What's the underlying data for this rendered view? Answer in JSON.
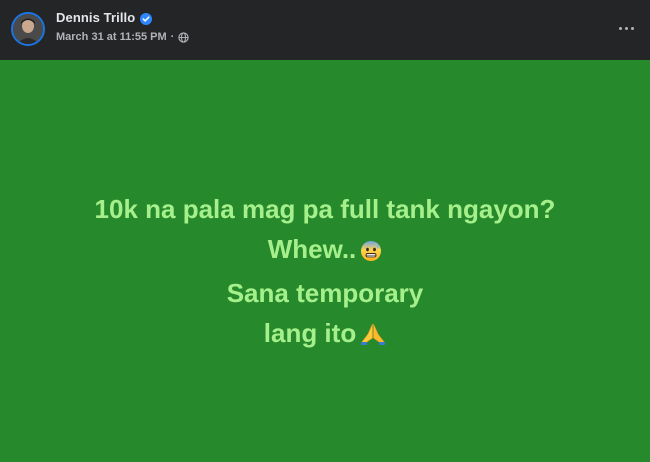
{
  "post": {
    "author": "Dennis Trillo",
    "timestamp": "March 31 at 11:55 PM",
    "separator": "·",
    "audience_icon": "globe-icon",
    "verified_icon": "verified-badge-icon",
    "more_icon": "more-options-icon"
  },
  "content": {
    "background_color": "#268a2c",
    "text_color": "#a6f08c",
    "lines": [
      "10k na pala mag pa full tank ngayon?",
      "Whew..",
      "Sana temporary",
      "lang ito"
    ],
    "emojis": [
      "anxious-face-emoji",
      "folded-hands-emoji"
    ]
  }
}
